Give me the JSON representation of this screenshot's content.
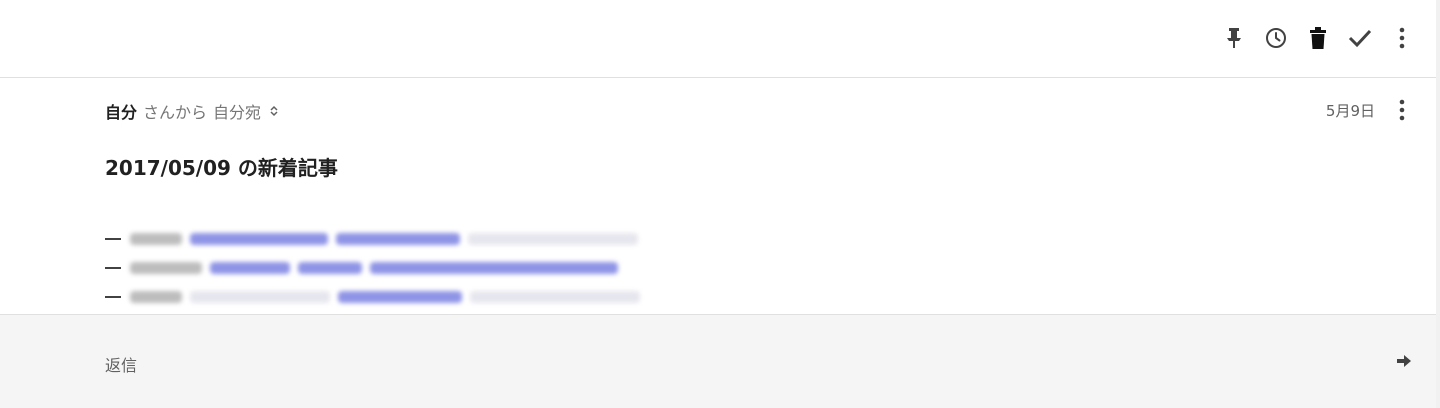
{
  "toolbar": {
    "actions": [
      {
        "name": "pin-icon"
      },
      {
        "name": "clock-icon"
      },
      {
        "name": "trash-icon"
      },
      {
        "name": "check-icon"
      },
      {
        "name": "more-vert-icon"
      }
    ]
  },
  "message": {
    "sender": "自分",
    "from_suffix": "さんから",
    "recipient": "自分宛",
    "date": "5月9日",
    "subject": "2017/05/09 の新着記事",
    "links_note": "blurred link list",
    "link_count": 3
  },
  "reply": {
    "label": "返信"
  },
  "colors": {
    "text_primary": "#212121",
    "text_secondary": "#757575",
    "reply_bg": "#f5f5f5",
    "divider": "#e0e0e0",
    "blurred_link": "#8f94e6"
  }
}
